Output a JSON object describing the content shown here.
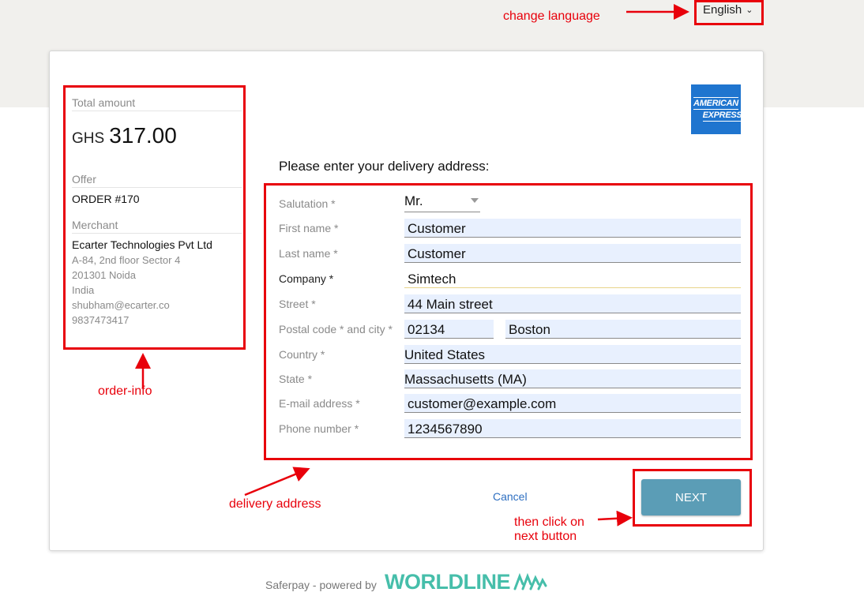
{
  "header": {
    "language": "English",
    "language_chevron_icon": "chevron-down-icon"
  },
  "order_info": {
    "total_amount_label": "Total amount",
    "currency": "GHS",
    "amount": "317.00",
    "offer_label": "Offer",
    "offer_value": "ORDER #170",
    "merchant_label": "Merchant",
    "merchant_name": "Ecarter Technologies Pvt Ltd",
    "merchant_address_1": "A-84, 2nd floor Sector 4",
    "merchant_address_2": "201301 Noida",
    "merchant_country": "India",
    "merchant_email": "shubham@ecarter.co",
    "merchant_phone": "9837473417"
  },
  "card_brand": {
    "line1": "AMERICAN",
    "line2": "EXPRESS"
  },
  "form": {
    "title": "Please enter your delivery address:",
    "salutation": {
      "label": "Salutation *",
      "value": "Mr."
    },
    "first_name": {
      "label": "First name *",
      "value": "Customer"
    },
    "last_name": {
      "label": "Last name *",
      "value": "Customer"
    },
    "company": {
      "label": "Company *",
      "value": "Simtech"
    },
    "street": {
      "label": "Street *",
      "value": "44 Main street"
    },
    "postal_city": {
      "label": "Postal code * and city *",
      "postal": "02134",
      "city": "Boston"
    },
    "country": {
      "label": "Country *",
      "value": "United States"
    },
    "state": {
      "label": "State *",
      "value": "Massachusetts (MA)"
    },
    "email": {
      "label": "E-mail address *",
      "value": "customer@example.com"
    },
    "phone": {
      "label": "Phone number *",
      "value": "1234567890"
    }
  },
  "actions": {
    "cancel_label": "Cancel",
    "next_label": "NEXT"
  },
  "footer": {
    "text": "Saferpay - powered by",
    "brand": "WORLDLINE"
  },
  "annotations": {
    "change_language": "change language",
    "order_info": "order-info",
    "delivery_address": "delivery address",
    "next_line1": "then click on",
    "next_line2": "next button"
  },
  "colors": {
    "annotation_red": "#e8000b",
    "next_button": "#5b9db6",
    "link_blue": "#2e6fc1",
    "amex_blue": "#1f75cf",
    "worldline_teal": "#46beaa",
    "autofill_bg": "#e8f0fe"
  }
}
